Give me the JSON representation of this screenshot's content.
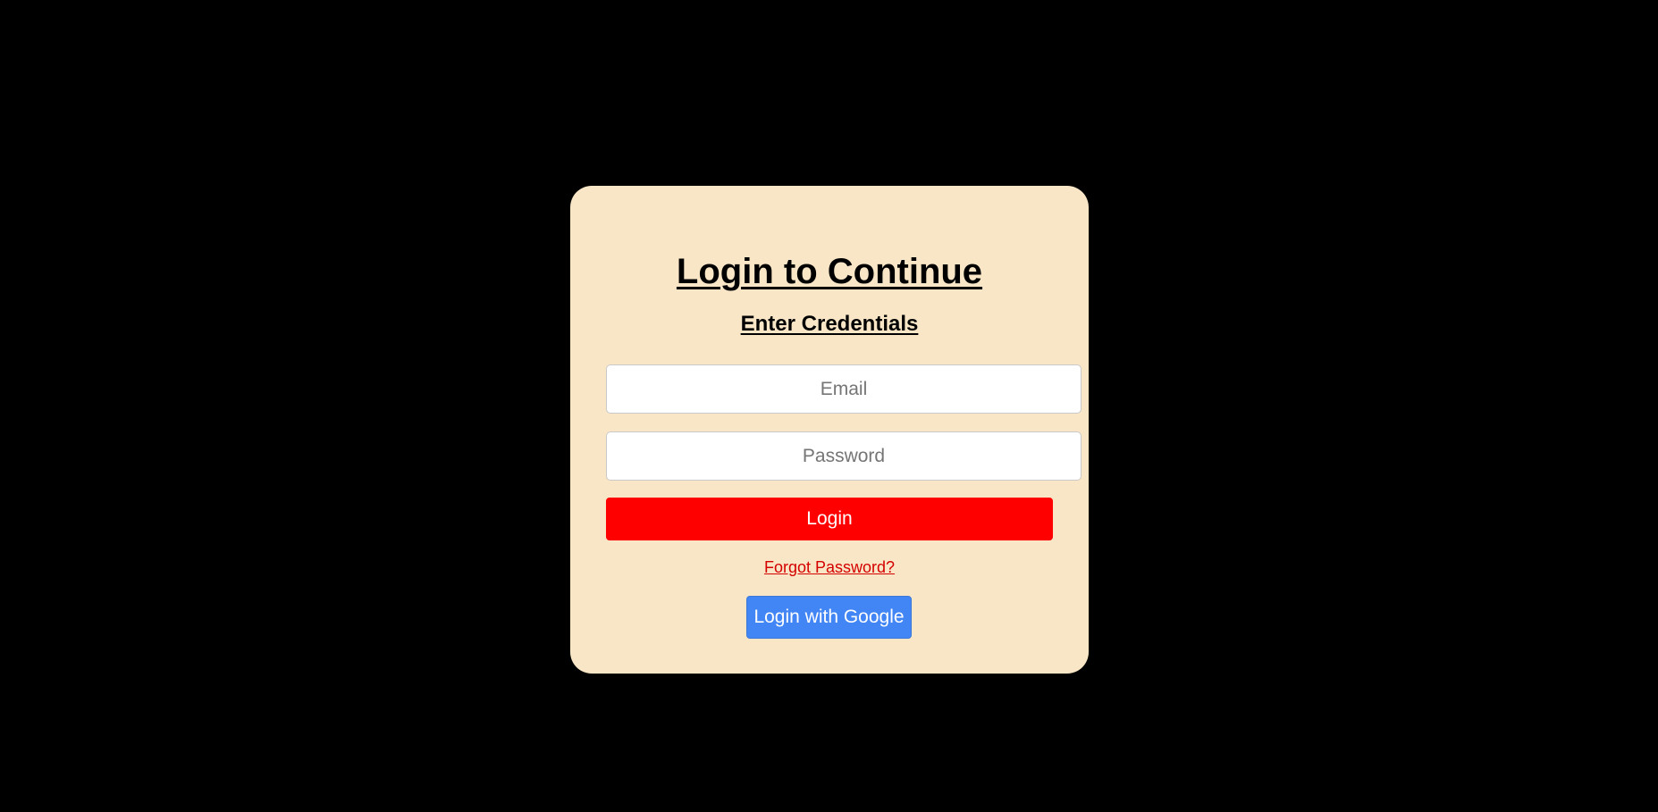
{
  "colors": {
    "page_background": "#000000",
    "card_background": "#f9e6c6",
    "login_button": "#ff0000",
    "forgot_link": "#d40000",
    "google_button": "#4285f4"
  },
  "login_card": {
    "title": "Login to Continue",
    "subtitle": "Enter Credentials",
    "email": {
      "placeholder": "Email",
      "value": ""
    },
    "password": {
      "placeholder": "Password",
      "value": ""
    },
    "login_button_label": "Login",
    "forgot_password_label": "Forgot Password?",
    "google_button_label": "Login with Google"
  }
}
